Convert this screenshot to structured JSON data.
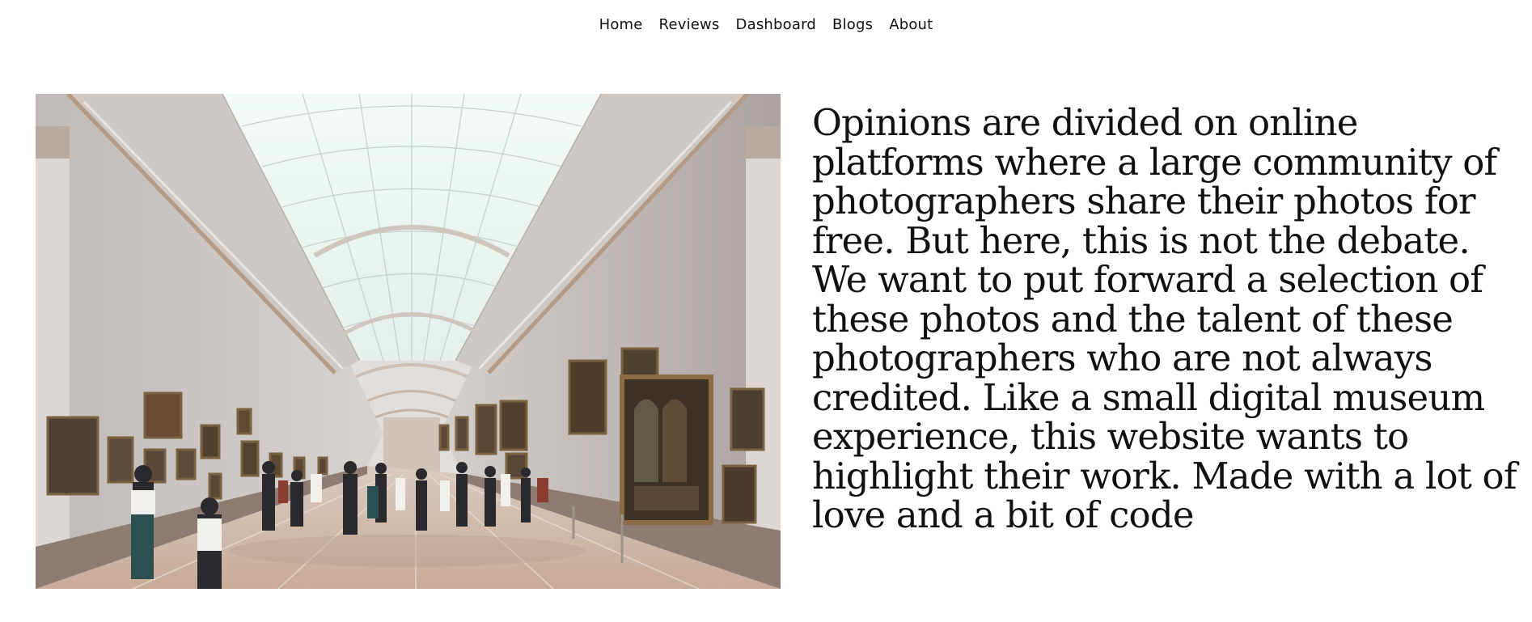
{
  "nav": {
    "items": [
      {
        "label": "Home"
      },
      {
        "label": "Reviews"
      },
      {
        "label": "Dashboard"
      },
      {
        "label": "Blogs"
      },
      {
        "label": "About"
      }
    ]
  },
  "hero": {
    "image_subject": "museum-gallery-photo",
    "text": "Opinions are divided on online platforms where a large community of photographers share their photos for free. But here, this is not the debate. We want to put forward a selection of these photos and the talent of these photographers who are not always credited. Like a small digital museum experience, this website wants to highlight their work. Made with a lot of love and a bit of code"
  }
}
